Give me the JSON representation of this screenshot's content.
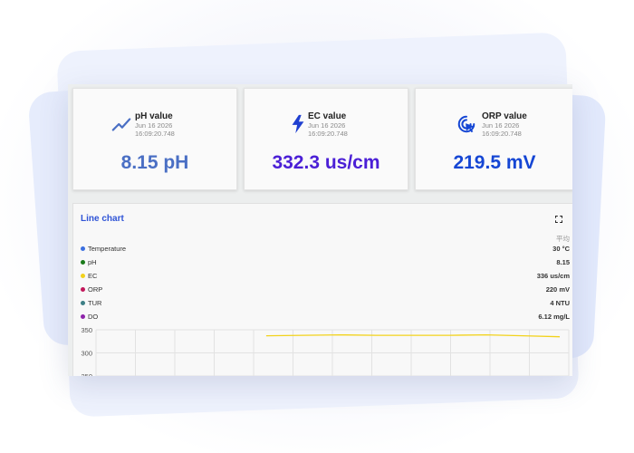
{
  "cards": [
    {
      "title": "pH value",
      "date": "Jun 16 2026",
      "time": "16:09:20.748",
      "value": "8.15 pH",
      "icon": "trending-up-icon",
      "color": "#4a6fc4"
    },
    {
      "title": "EC value",
      "date": "Jun 16 2026",
      "time": "16:09:20.748",
      "value": "332.3 us/cm",
      "icon": "lightning-bolt-icon",
      "color": "#4b1fd6"
    },
    {
      "title": "ORP value",
      "date": "Jun 16 2026",
      "time": "16:09:20.748",
      "value": "219.5 mV",
      "icon": "cursor-target-icon",
      "color": "#1546d4"
    }
  ],
  "chart_panel": {
    "title": "Line chart",
    "fullscreen_icon": "fullscreen-icon",
    "avg_header": "平均",
    "legend": [
      {
        "name": "Temperature",
        "value": "30 °C",
        "color": "#3b6fe0"
      },
      {
        "name": "pH",
        "value": "8.15",
        "color": "#1a7a1a"
      },
      {
        "name": "EC",
        "value": "336 us/cm",
        "color": "#f2d21b"
      },
      {
        "name": "ORP",
        "value": "220 mV",
        "color": "#c2185b"
      },
      {
        "name": "TUR",
        "value": "4 NTU",
        "color": "#3d7f86"
      },
      {
        "name": "DO",
        "value": "6.12 mg/L",
        "color": "#8e24aa"
      }
    ]
  },
  "chart_data": {
    "type": "line",
    "ylim": [
      250,
      350
    ],
    "yticks": [
      "350",
      "300",
      "250"
    ],
    "grid": true,
    "series": [
      {
        "name": "EC",
        "color": "#f2d21b",
        "values": [
          337,
          338,
          339,
          338,
          338,
          338,
          339,
          337,
          335
        ]
      }
    ]
  }
}
